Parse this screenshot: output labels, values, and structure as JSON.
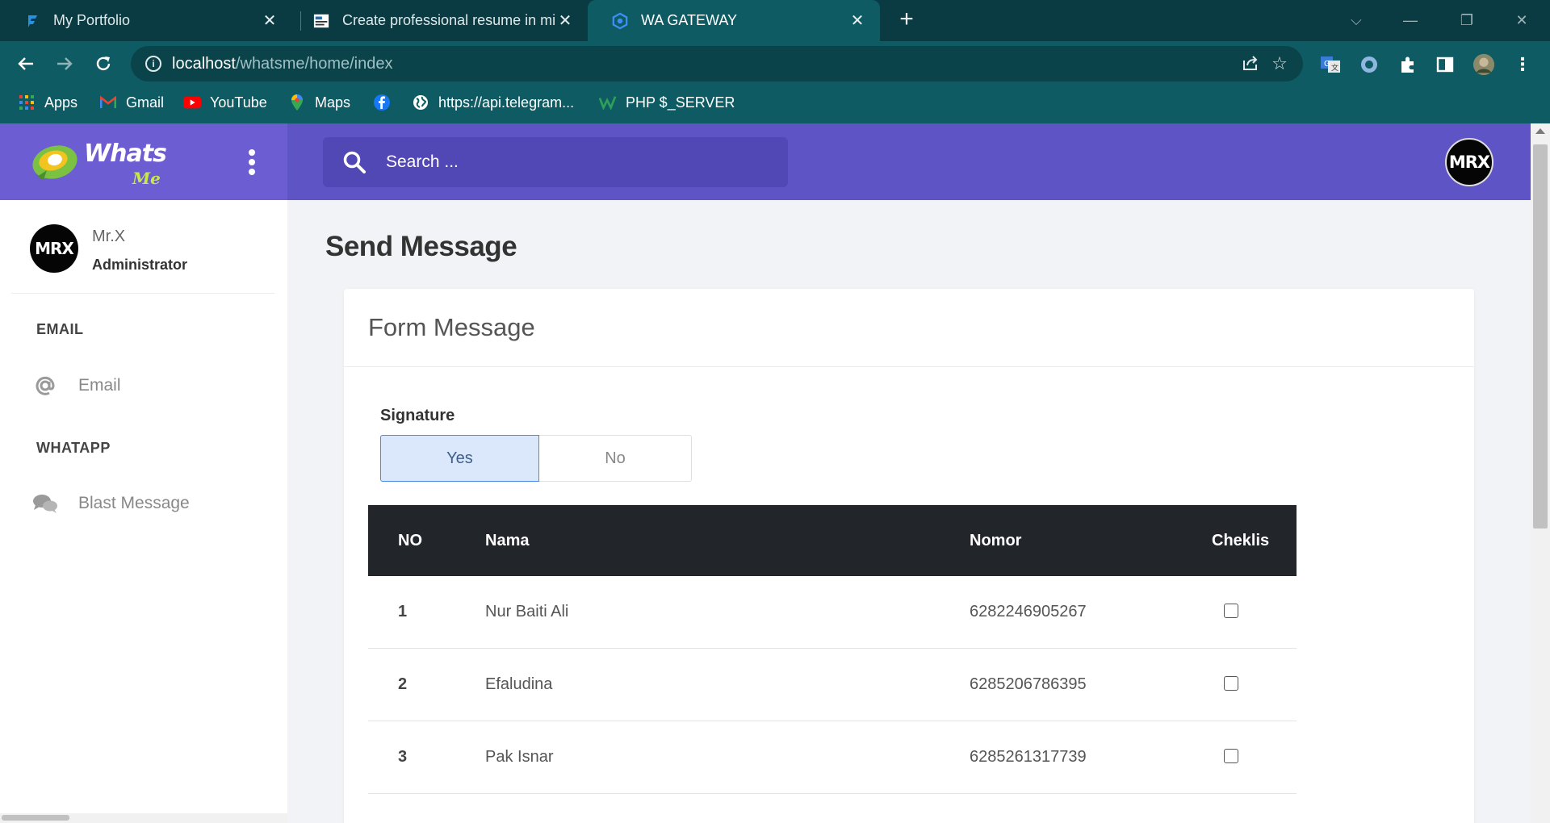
{
  "browser": {
    "tabs": [
      {
        "title": "My Portfolio",
        "active": false,
        "icon": "portfolio-favicon"
      },
      {
        "title": "Create professional resume in mi",
        "active": false,
        "icon": "resume-favicon"
      },
      {
        "title": "WA GATEWAY",
        "active": true,
        "icon": "shield-favicon"
      }
    ],
    "url_host": "localhost",
    "url_path": "/whatsme/home/index",
    "bookmarks": [
      {
        "label": "Apps",
        "icon": "apps-grid-icon"
      },
      {
        "label": "Gmail",
        "icon": "gmail-icon"
      },
      {
        "label": "YouTube",
        "icon": "youtube-icon"
      },
      {
        "label": "Maps",
        "icon": "maps-pin-icon"
      },
      {
        "label": "",
        "icon": "facebook-icon"
      },
      {
        "label": "https://api.telegram...",
        "icon": "globe-icon"
      },
      {
        "label": "PHP $_SERVER",
        "icon": "w-icon"
      }
    ]
  },
  "app": {
    "logo_text": "Whats",
    "logo_sub": "Me",
    "search_placeholder": "Search ...",
    "avatar_text": "MRX",
    "colors": {
      "brand": "#6c5dd3",
      "header": "#5f54c6",
      "table_head": "#22252a",
      "toggle_active": "#dbe8fc"
    }
  },
  "sidebar": {
    "user_name": "Mr.X",
    "user_role": "Administrator",
    "sections": [
      {
        "heading": "EMAIL",
        "items": [
          {
            "label": "Email",
            "icon": "at-icon"
          }
        ]
      },
      {
        "heading": "WHATAPP",
        "items": [
          {
            "label": "Blast Message",
            "icon": "chat-bubbles-icon"
          }
        ]
      }
    ]
  },
  "main": {
    "page_title": "Send Message",
    "card_title": "Form Message",
    "signature_label": "Signature",
    "signature_options": [
      "Yes",
      "No"
    ],
    "signature_selected": "Yes",
    "table": {
      "columns": [
        "NO",
        "Nama",
        "Nomor",
        "Cheklis"
      ],
      "rows": [
        {
          "no": "1",
          "nama": "Nur Baiti Ali",
          "nomor": "6282246905267",
          "checked": false
        },
        {
          "no": "2",
          "nama": "Efaludina",
          "nomor": "6285206786395",
          "checked": false
        },
        {
          "no": "3",
          "nama": "Pak Isnar",
          "nomor": "6285261317739",
          "checked": false
        }
      ]
    }
  }
}
